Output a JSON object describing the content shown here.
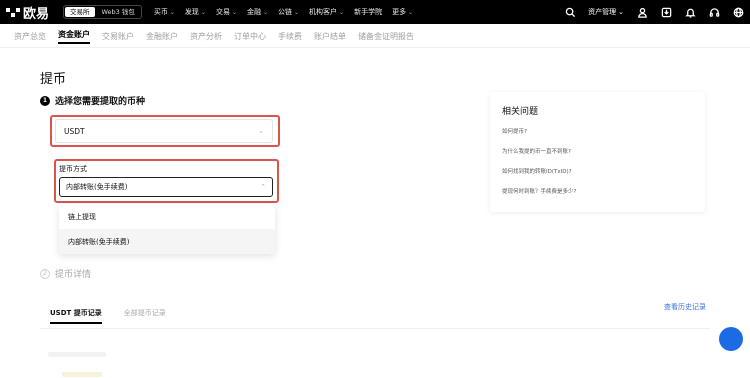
{
  "topbar": {
    "brand": "欧易",
    "modes": [
      "交易所",
      "Web3 钱包"
    ],
    "nav": [
      "买币",
      "发现",
      "交易",
      "金融",
      "公链",
      "机构客户",
      "新手学院",
      "更多"
    ],
    "asset_manager": "资产管理"
  },
  "subtabs": [
    "资产总览",
    "资金账户",
    "交易账户",
    "金融账户",
    "资产分析",
    "订单中心",
    "手续费",
    "账户结单",
    "储备金证明报告"
  ],
  "page": {
    "title": "提币",
    "step1_num": "1",
    "step1_label": "选择您需要提取的币种",
    "coin_value": "USDT",
    "method_label": "提币方式",
    "method_value": "内部转账(免手续费)",
    "method_options": [
      "链上提现",
      "内部转账(免手续费)"
    ],
    "step2_num": "2",
    "step2_label": "提币详情"
  },
  "records": {
    "tabs": [
      "USDT 提币记录",
      "全部提币记录"
    ],
    "history_link": "查看历史记录"
  },
  "faq": {
    "title": "相关问题",
    "items": [
      "如何提币?",
      "为什么我提的币一直不到账?",
      "如何找到我的转账ID(TxID)?",
      "提现何时到账？手续费是多少?"
    ]
  },
  "colors": {
    "highlight": "#d9534f",
    "link": "#3b6fd8",
    "chat_button": "#1d6ae5"
  }
}
